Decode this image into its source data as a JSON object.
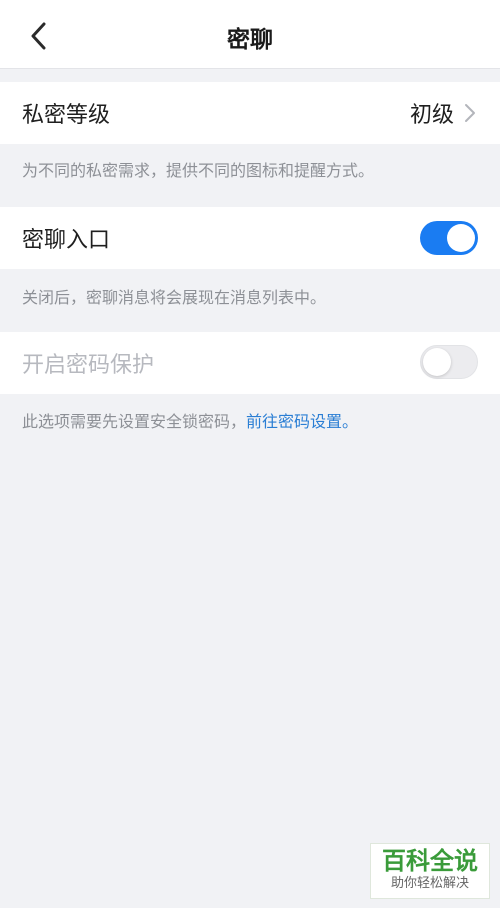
{
  "header": {
    "title": "密聊",
    "back_icon": "chevron-left-icon"
  },
  "settings": {
    "privacy_level": {
      "label": "私密等级",
      "value": "初级",
      "description": "为不同的私密需求，提供不同的图标和提醒方式。"
    },
    "chat_entry": {
      "label": "密聊入口",
      "enabled": true,
      "description": "关闭后，密聊消息将会展现在消息列表中。"
    },
    "password_protection": {
      "label": "开启密码保护",
      "enabled": false,
      "disabled": true,
      "description_prefix": "此选项需要先设置安全锁密码，",
      "description_link": "前往密码设置。"
    }
  },
  "colors": {
    "accent": "#1a7cf2",
    "link": "#2a7ed4",
    "background": "#f1f2f5"
  },
  "watermark": {
    "main": "百科全说",
    "sub": "助你轻松解决"
  }
}
